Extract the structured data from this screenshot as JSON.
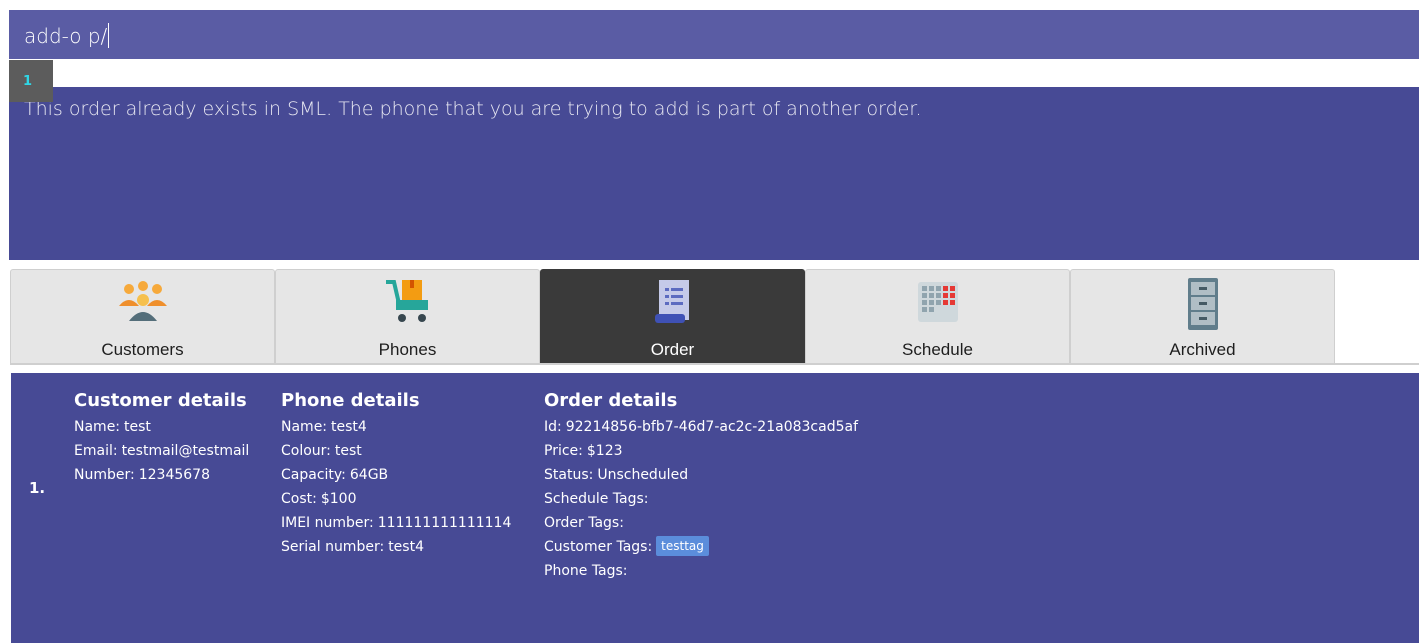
{
  "command": {
    "value": "add-o p/"
  },
  "history": {
    "badge": "1"
  },
  "result": {
    "message": "This order already exists in SML. The phone that you are trying to add is part of another order."
  },
  "tabs": [
    {
      "label": "Customers",
      "icon": "people-icon",
      "selected": false
    },
    {
      "label": "Phones",
      "icon": "shopping-cart-icon",
      "selected": false
    },
    {
      "label": "Order",
      "icon": "receipt-icon",
      "selected": true
    },
    {
      "label": "Schedule",
      "icon": "calendar-icon",
      "selected": false
    },
    {
      "label": "Archived",
      "icon": "filing-cabinet-icon",
      "selected": false
    }
  ],
  "orders": [
    {
      "index": "1.",
      "customer": {
        "heading": "Customer details",
        "name_label": "Name:",
        "name": "test",
        "email_label": "Email:",
        "email": "testmail@testmail",
        "number_label": "Number:",
        "number": "12345678"
      },
      "phone": {
        "heading": "Phone details",
        "name_label": "Name:",
        "name": "test4",
        "colour_label": "Colour:",
        "colour": "test",
        "capacity_label": "Capacity:",
        "capacity": "64GB",
        "cost_label": "Cost:",
        "cost": "$100",
        "imei_label": "IMEI number:",
        "imei": "111111111111114",
        "serial_label": "Serial number:",
        "serial": "test4"
      },
      "order": {
        "heading": "Order details",
        "id_label": "Id:",
        "id": "92214856-bfb7-46d7-ac2c-21a083cad5af",
        "price_label": "Price:",
        "price": "$123",
        "status_label": "Status:",
        "status": "Unscheduled",
        "schedule_tags_label": "Schedule Tags:",
        "order_tags_label": "Order Tags:",
        "customer_tags_label": "Customer Tags:",
        "customer_tags": [
          "testtag"
        ],
        "phone_tags_label": "Phone Tags:"
      }
    }
  ],
  "colors": {
    "command_bg": "#5a5ca4",
    "panel_bg": "#474a95",
    "tab_bg": "#e6e6e6",
    "tab_selected_bg": "#3a3a3a",
    "tag_bg": "#5b8ddb",
    "badge_text": "#2fd7e6"
  }
}
